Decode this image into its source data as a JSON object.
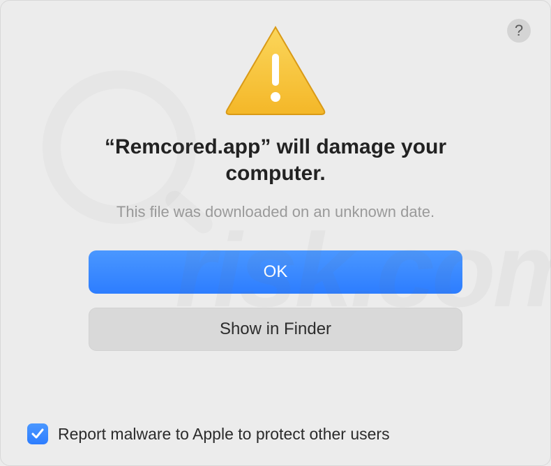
{
  "dialog": {
    "help_label": "?",
    "heading": "“Remcored.app” will damage your computer.",
    "subtext": "This file was downloaded on an unknown date.",
    "primary_button": "OK",
    "secondary_button": "Show in Finder",
    "checkbox_checked": true,
    "checkbox_label": "Report malware to Apple to protect other users"
  },
  "icons": {
    "warning": "warning-triangle",
    "help": "question-mark",
    "check": "checkmark"
  },
  "colors": {
    "accent": "#2d7dff",
    "bg": "#ececec",
    "button_secondary": "#d9d9d9",
    "text_muted": "#9a9a9a"
  },
  "watermark": {
    "text": "risk.com"
  }
}
